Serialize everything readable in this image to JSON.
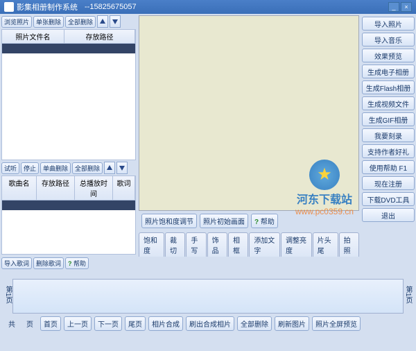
{
  "titlebar": {
    "title": "影集相册制作系统",
    "phone": "--15825675057"
  },
  "left": {
    "photo_toolbar": {
      "browse": "浏览照片",
      "delete_one": "单张删除",
      "delete_all": "全部删除"
    },
    "photo_grid": {
      "col_name": "照片文件名",
      "col_path": "存放路径"
    },
    "music_toolbar": {
      "preview": "试听",
      "stop": "停止",
      "delete_one": "单曲删除",
      "delete_all": "全部删除"
    },
    "music_grid": {
      "col_name": "歌曲名",
      "col_path": "存放路径",
      "col_time": "总播放时间",
      "col_lyric": "歌词"
    },
    "lyric_toolbar": {
      "import": "导入歌词",
      "delete": "删除歌词",
      "help": "帮助"
    }
  },
  "center": {
    "preview_buttons": {
      "saturation": "照片饱和度调节",
      "initial": "照片初始画面",
      "help": "帮助"
    },
    "tabs": [
      "饱和度",
      "裁切",
      "手写",
      "饰品",
      "相框",
      "添加文字",
      "调整亮度",
      "片头尾",
      "拍照"
    ]
  },
  "right": {
    "buttons": [
      "导入照片",
      "导入音乐",
      "效果预览",
      "生成电子相册",
      "生成Flash相册",
      "生成视频文件",
      "生成GIF相册",
      "我要刻录",
      "支持作者好礼",
      "使用帮助  F1",
      "现在注册",
      "下载DVD工具",
      "退出"
    ]
  },
  "bottom": {
    "page_label": "第1页",
    "total_prefix": "共",
    "total_suffix": "页",
    "nav": [
      "首页",
      "上一页",
      "下一页",
      "尾页",
      "相片合成",
      "刷出合成相片",
      "全部删除",
      "刷新图片",
      "照片全屏预览"
    ]
  },
  "watermark": {
    "site_name": "河东下载站",
    "url": "www.pc0359.cn"
  }
}
